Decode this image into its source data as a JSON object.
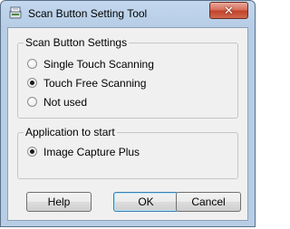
{
  "window": {
    "title": "Scan Button Setting Tool",
    "close_glyph": "✕"
  },
  "scan_group": {
    "label": "Scan Button Settings",
    "options": [
      {
        "label": "Single Touch Scanning",
        "checked": false
      },
      {
        "label": "Touch Free Scanning",
        "checked": true
      },
      {
        "label": "Not used",
        "checked": false
      }
    ]
  },
  "app_group": {
    "label": "Application to start",
    "options": [
      {
        "label": "Image Capture Plus",
        "checked": true
      }
    ]
  },
  "buttons": {
    "help": "Help",
    "ok": "OK",
    "cancel": "Cancel"
  },
  "icons": {
    "app": "scanner-settings-icon"
  },
  "colors": {
    "titlebar": "#b7cde6",
    "client": "#f0f0f0",
    "close": "#c2432c"
  }
}
